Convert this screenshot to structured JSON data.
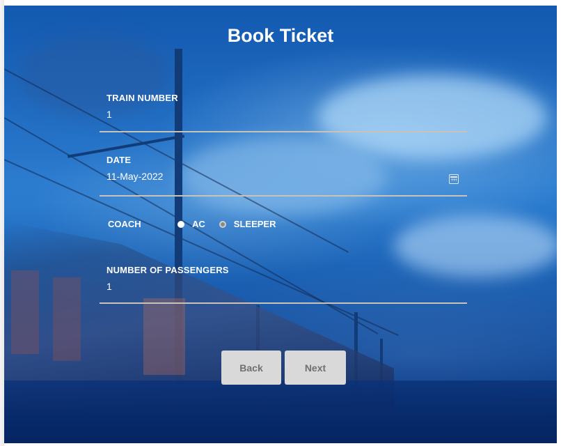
{
  "page": {
    "title": "Book Ticket"
  },
  "form": {
    "train_number": {
      "label": "TRAIN NUMBER",
      "value": "1"
    },
    "date": {
      "label": "DATE",
      "value": "11-May-2022",
      "icon": "calendar-icon"
    },
    "coach": {
      "label": "COACH",
      "options": [
        {
          "label": "AC",
          "selected": true
        },
        {
          "label": "SLEEPER",
          "selected": false
        }
      ]
    },
    "passengers": {
      "label": "NUMBER OF PASSENGERS",
      "value": "1"
    }
  },
  "actions": {
    "back_label": "Back",
    "next_label": "Next"
  },
  "colors": {
    "accent": "#d9d9d9",
    "underline": "#c9c2b8",
    "overlay": "#1e64b8"
  }
}
